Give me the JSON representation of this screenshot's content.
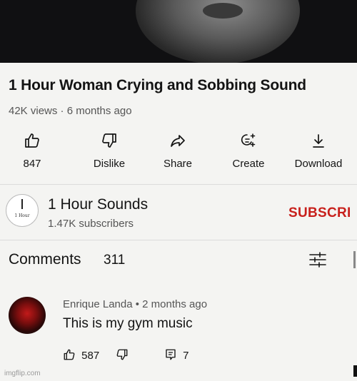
{
  "video": {
    "title": "1 Hour Woman Crying and Sobbing Sound",
    "meta": "42K views · 6 months ago"
  },
  "actions": [
    {
      "label": "847",
      "icon": "thumbs-up-icon"
    },
    {
      "label": "Dislike",
      "icon": "thumbs-down-icon"
    },
    {
      "label": "Share",
      "icon": "share-arrow-icon"
    },
    {
      "label": "Create",
      "icon": "create-sparkle-icon"
    },
    {
      "label": "Download",
      "icon": "download-icon"
    }
  ],
  "channel": {
    "avatar_text": "1 Hour",
    "name": "1 Hour Sounds",
    "subscribers": "1.47K subscribers",
    "subscribe_label": "SUBSCRI"
  },
  "comments": {
    "heading": "Comments",
    "count": "311",
    "items": [
      {
        "author": "Enrique Landa • 2 months ago",
        "text": "This is my gym music",
        "likes": "587",
        "replies": "7"
      }
    ]
  },
  "watermark": "imgflip.com",
  "colors": {
    "subscribe": "#c8201c",
    "background": "#f4f4f2"
  }
}
